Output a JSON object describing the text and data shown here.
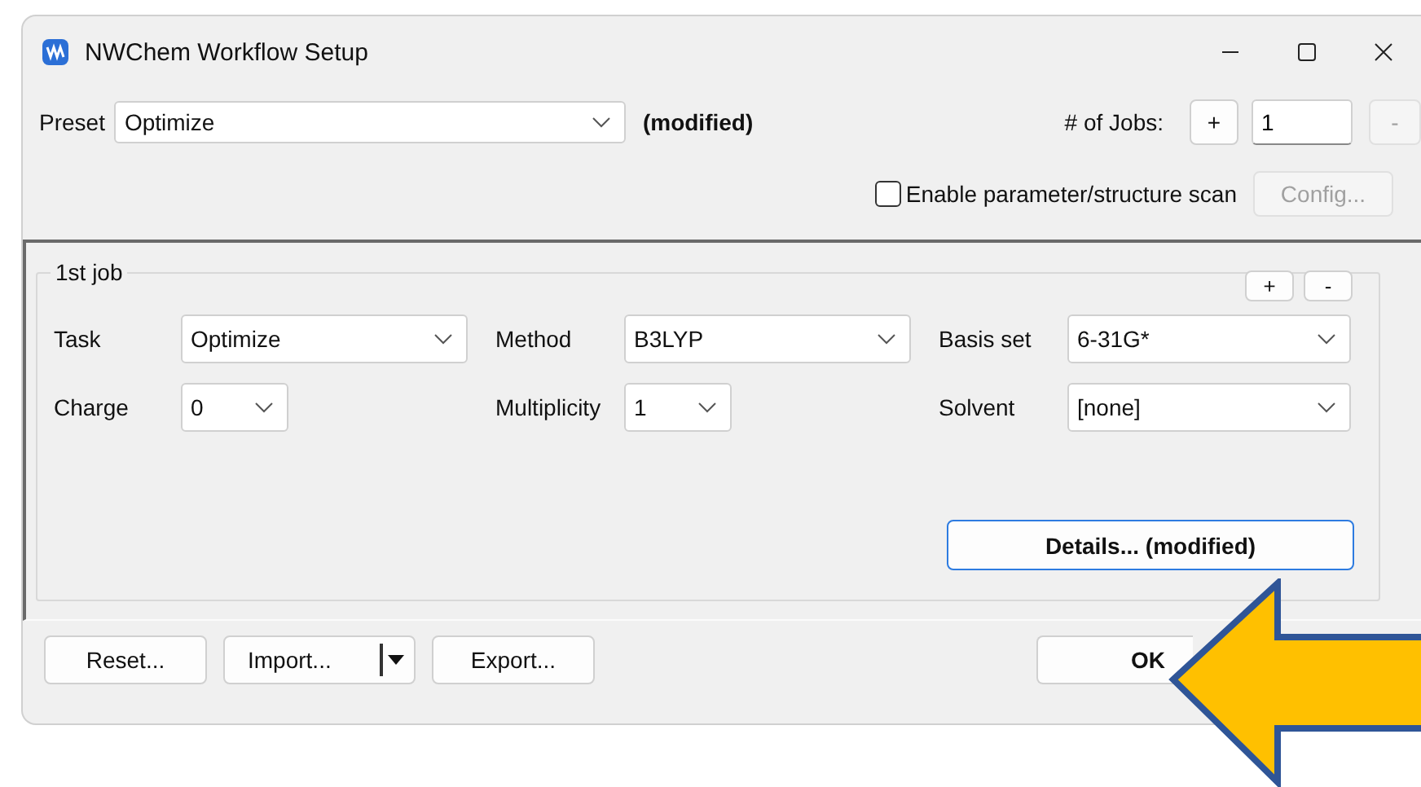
{
  "window": {
    "title": "NWChem Workflow Setup"
  },
  "preset": {
    "label": "Preset",
    "value": "Optimize",
    "note": "(modified)"
  },
  "jobs": {
    "label": "# of Jobs:",
    "add": "+",
    "value": "1",
    "remove": "-",
    "remove_disabled": true
  },
  "scan": {
    "label": "Enable parameter/structure scan",
    "checked": false,
    "config": "Config...",
    "config_disabled": true
  },
  "job": {
    "title": "1st job",
    "add": "+",
    "remove": "-",
    "fields": [
      {
        "label": "Task",
        "value": "Optimize",
        "kind": "long"
      },
      {
        "label": "Method",
        "value": "B3LYP",
        "kind": "long"
      },
      {
        "label": "Basis set",
        "value": "6-31G*",
        "kind": "long"
      },
      {
        "label": "Charge",
        "value": "0",
        "kind": "short"
      },
      {
        "label": "Multiplicity",
        "value": "1",
        "kind": "short"
      },
      {
        "label": "Solvent",
        "value": "[none]",
        "kind": "long"
      }
    ],
    "details": "Details... (modified)"
  },
  "buttons": [
    {
      "label": "Reset...",
      "kind": "plain"
    },
    {
      "label": "Import...",
      "kind": "split"
    },
    {
      "label": "Export...",
      "kind": "plain"
    },
    {
      "label": "OK",
      "kind": "default"
    }
  ]
}
